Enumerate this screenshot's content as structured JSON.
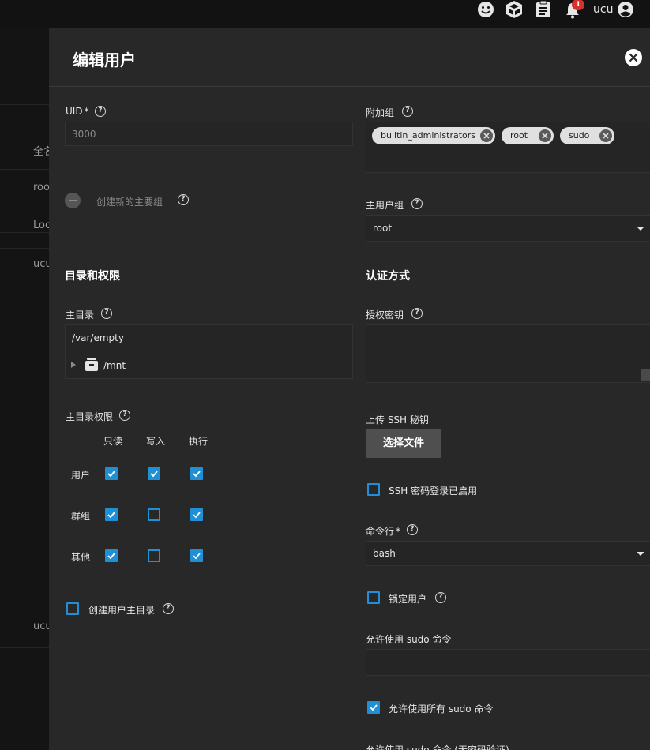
{
  "topbar": {
    "notification_count": "1",
    "username": "ucu",
    "icons": [
      "smiley-icon",
      "truenas-cube-icon",
      "clipboard-icon",
      "bell-icon",
      "account-circle-icon"
    ]
  },
  "background": {
    "header_text": "全名",
    "rows": [
      "roo",
      "Loc",
      "ucu",
      "ucu"
    ]
  },
  "dialog": {
    "title": "编辑用户",
    "uid": {
      "label": "UID",
      "required": "*",
      "value": "3000"
    },
    "aux_groups": {
      "label": "附加组",
      "chips": [
        "builtin_administrators",
        "root",
        "sudo"
      ]
    },
    "create_primary_group": {
      "label": "创建新的主要组"
    },
    "primary_group": {
      "label": "主用户组",
      "value": "root"
    },
    "sections": {
      "directories": "目录和权限",
      "auth": "认证方式"
    },
    "home_dir": {
      "label": "主目录",
      "value": "/var/empty",
      "tree_item": "/mnt"
    },
    "authorized_keys": {
      "label": "授权密钥"
    },
    "home_perms": {
      "label": "主目录权限",
      "columns": [
        "只读",
        "写入",
        "执行"
      ],
      "rows": [
        {
          "name": "用户",
          "values": [
            true,
            true,
            true
          ]
        },
        {
          "name": "群组",
          "values": [
            true,
            false,
            true
          ]
        },
        {
          "name": "其他",
          "values": [
            true,
            false,
            true
          ]
        }
      ]
    },
    "upload_ssh": {
      "label": "上传 SSH 秘钥",
      "button": "选择文件"
    },
    "ssh_password_enabled": {
      "label": "SSH 密码登录已启用",
      "checked": false
    },
    "shell": {
      "label": "命令行",
      "required": "*",
      "value": "bash"
    },
    "create_home": {
      "label": "创建用户主目录",
      "checked": false
    },
    "lock_user": {
      "label": "锁定用户",
      "checked": false
    },
    "sudo_commands": {
      "label": "允许使用 sudo 命令",
      "value": ""
    },
    "sudo_all": {
      "label": "允许使用所有 sudo 命令",
      "checked": true
    },
    "sudo_nopasswd": {
      "label": "允许使用 sudo 命令 (无密码验证)"
    }
  }
}
